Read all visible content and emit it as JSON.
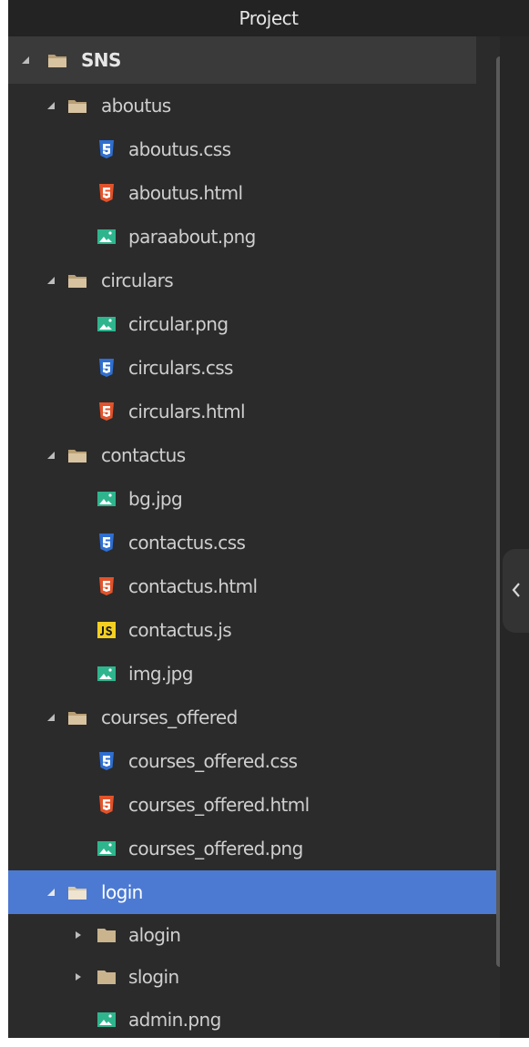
{
  "panel": {
    "title": "Project"
  },
  "tree": {
    "root": "SNS",
    "folders": {
      "aboutus": "aboutus",
      "circulars": "circulars",
      "contactus": "contactus",
      "courses_offered": "courses_offered",
      "login": "login",
      "alogin": "alogin",
      "slogin": "slogin"
    },
    "files": {
      "aboutus_css": "aboutus.css",
      "aboutus_html": "aboutus.html",
      "paraabout_png": "paraabout.png",
      "circular_png": "circular.png",
      "circulars_css": "circulars.css",
      "circulars_html": "circulars.html",
      "bg_jpg": "bg.jpg",
      "contactus_css": "contactus.css",
      "contactus_html": "contactus.html",
      "contactus_js": "contactus.js",
      "img_jpg": "img.jpg",
      "courses_offered_css": "courses_offered.css",
      "courses_offered_html": "courses_offered.html",
      "courses_offered_png": "courses_offered.png",
      "admin_png": "admin.png"
    },
    "selected": "login"
  },
  "icons": {
    "folder-open": "folder-open-icon",
    "folder-closed": "folder-icon",
    "css-file": "css3-icon",
    "html-file": "html5-icon",
    "image-file": "image-icon",
    "js-file": "js-icon",
    "expanded": "caret-down-icon",
    "collapsed": "caret-right-icon",
    "collapse-panel": "chevron-left-icon"
  },
  "colors": {
    "background": "#2b2b2b",
    "selection": "#4c7ad3",
    "folder": "#c9b48e",
    "css": "#2f6fd1",
    "html": "#e2532b",
    "image": "#2fb58e",
    "js": "#f5d020"
  }
}
